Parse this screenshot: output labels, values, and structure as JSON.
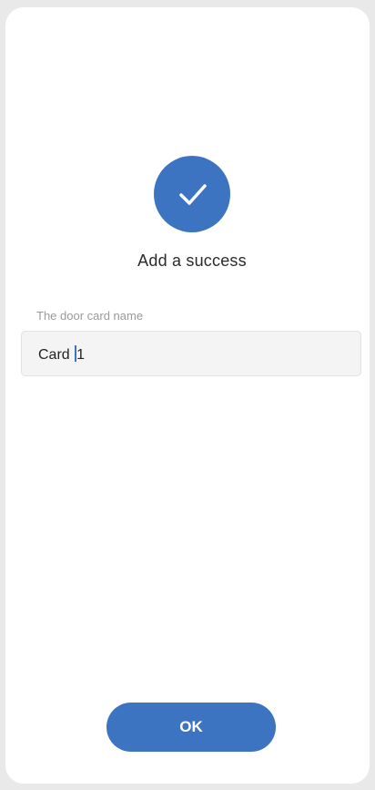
{
  "status": {
    "icon": "checkmark-icon",
    "message": "Add a success"
  },
  "form": {
    "field_label": "The door card name",
    "field_value": "Card 1"
  },
  "actions": {
    "ok_label": "OK"
  },
  "colors": {
    "accent": "#3d74c2",
    "background": "#ffffff",
    "input_bg": "#f4f4f4"
  }
}
